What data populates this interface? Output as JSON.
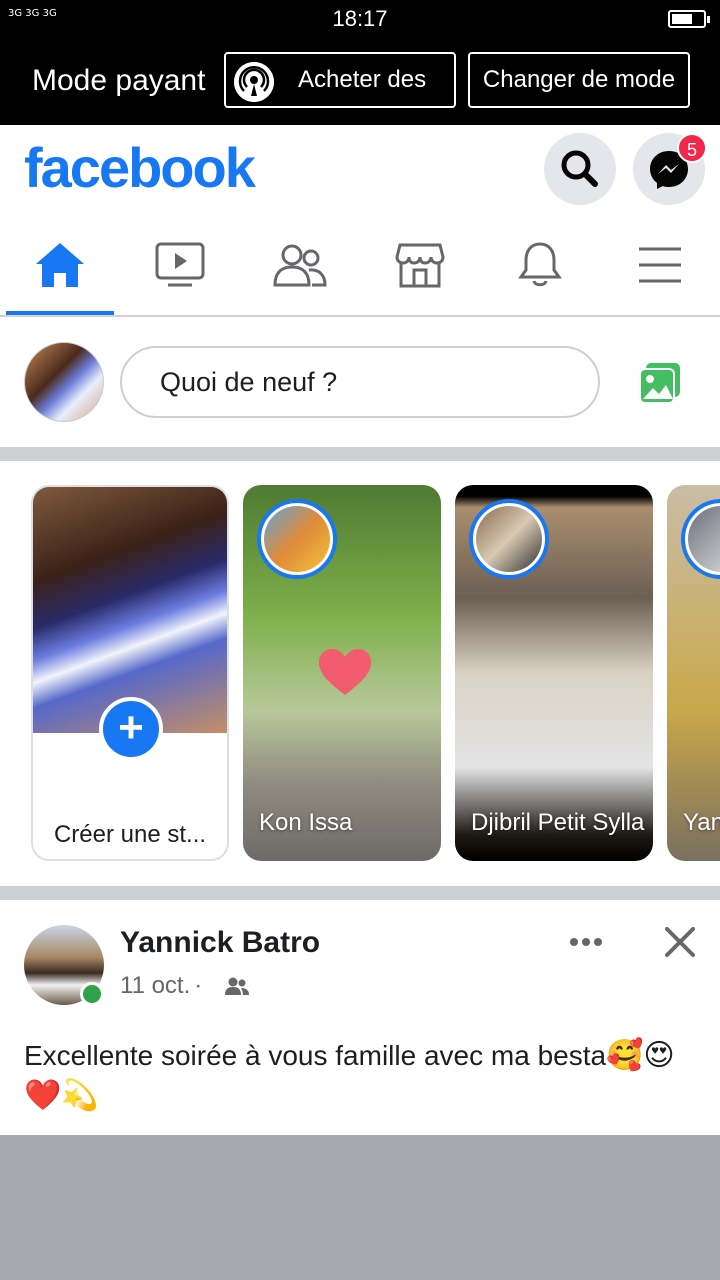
{
  "status_bar": {
    "signal_text": "3G 3G 3G",
    "time": "18:17"
  },
  "pay_mode_bar": {
    "title": "Mode payant",
    "buy_label": "Acheter des",
    "change_label": "Changer de mode"
  },
  "header": {
    "logo": "facebook",
    "messenger_badge": "5",
    "colors": {
      "brand": "#1877f2",
      "badge": "#f02849"
    }
  },
  "nav": {
    "tabs": [
      {
        "name": "home",
        "icon": "home-icon",
        "active": true
      },
      {
        "name": "watch",
        "icon": "video-icon"
      },
      {
        "name": "friends",
        "icon": "friends-icon"
      },
      {
        "name": "marketplace",
        "icon": "shop-icon"
      },
      {
        "name": "notifications",
        "icon": "bell-icon"
      },
      {
        "name": "menu",
        "icon": "hamburger-icon"
      }
    ]
  },
  "composer": {
    "placeholder": "Quoi de neuf ?"
  },
  "stories": {
    "create_label": "Créer une st...",
    "items": [
      {
        "name": "Kon Issa"
      },
      {
        "name": "Djibril Petit Sylla"
      },
      {
        "name": "Yan"
      }
    ]
  },
  "post": {
    "author": "Yannick Batro",
    "date": "11 oct.",
    "text": "Excellente soirée à vous famille avec ma besta",
    "emojis": "🥰😍❤️💫"
  }
}
